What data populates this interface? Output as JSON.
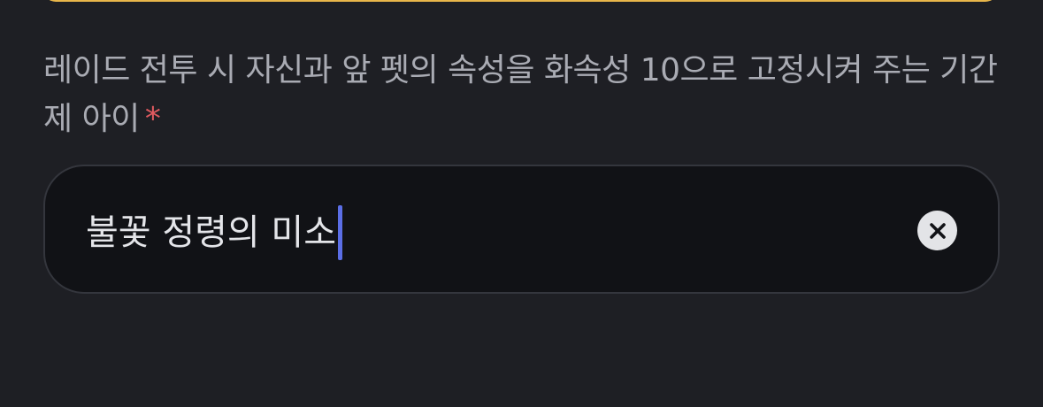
{
  "field": {
    "label": "레이드 전투 시 자신과 앞 펫의 속성을 화속성 10으로 고정시켜 주는 기간제 아이",
    "required_mark": "*",
    "input_value": "불꽃 정령의 미소"
  },
  "icons": {
    "clear": "close-circle-icon"
  },
  "colors": {
    "background": "#1e1f24",
    "input_background": "#111216",
    "input_border": "#34363d",
    "label": "#a9abb3",
    "required": "#e05a5f",
    "caret": "#5b6ee6",
    "previous_field_border": "#e8b64a"
  }
}
